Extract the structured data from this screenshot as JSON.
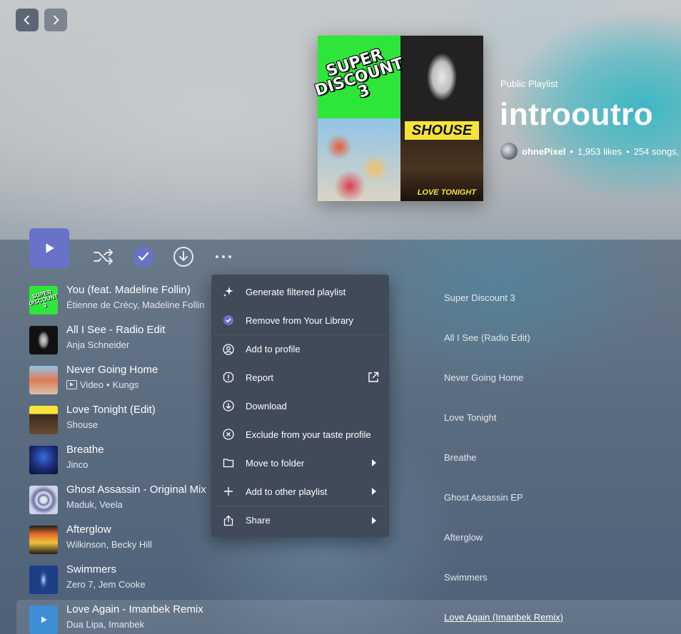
{
  "colors": {
    "accent": "#6872c8",
    "menu_bg": "#414a59"
  },
  "nav": {
    "back_icon": "chevron-left-icon",
    "forward_icon": "chevron-right-icon"
  },
  "cover": {
    "q1_text": "SUPER DISCOUNT 3",
    "q4_text": "SHOUSE",
    "q4_subtext": "LOVE TONIGHT"
  },
  "playlist": {
    "type": "Public Playlist",
    "title": "introoutro",
    "owner": "ohnePixel",
    "likes": "1,953 likes",
    "songs": "254 songs,",
    "separator": "•"
  },
  "controls": {
    "play_icon": "play-icon",
    "shuffle_icon": "shuffle-icon",
    "saved_icon": "check-circle-icon",
    "download_icon": "download-icon",
    "more_icon": "more-icon"
  },
  "tracks": [
    {
      "name": "You (feat. Madeline Follin)",
      "artist": "Étienne de Crécy, Madeline Follin",
      "album": "Super Discount 3"
    },
    {
      "name": "All I See - Radio Edit",
      "artist": "Anja Schneider",
      "album": "All I See (Radio Edit)"
    },
    {
      "name": "Never Going Home",
      "artist_prefix": "Video",
      "artist": "Kungs",
      "album": "Never Going Home"
    },
    {
      "name": "Love Tonight (Edit)",
      "artist": "Shouse",
      "album": "Love Tonight"
    },
    {
      "name": "Breathe",
      "artist": "Jinco",
      "album": "Breathe"
    },
    {
      "name": "Ghost Assassin - Original Mix",
      "artist": "Maduk, Veela",
      "album": "Ghost Assassin EP"
    },
    {
      "name": "Afterglow",
      "artist": "Wilkinson, Becky Hill",
      "album": "Afterglow"
    },
    {
      "name": "Swimmers",
      "artist": "Zero 7, Jem Cooke",
      "album": "Swimmers"
    },
    {
      "name": "Love Again - Imanbek Remix",
      "artist": "Dua Lipa, Imanbek",
      "album": "Love Again (Imanbek Remix)"
    }
  ],
  "menu": {
    "items": [
      {
        "label": "Generate filtered playlist",
        "icon": "sparkle-icon"
      },
      {
        "label": "Remove from Your Library",
        "icon": "check-circle-icon"
      },
      {
        "label": "Add to profile",
        "icon": "user-circle-icon"
      },
      {
        "label": "Report",
        "icon": "report-icon",
        "tail": "external-link-icon"
      },
      {
        "label": "Download",
        "icon": "download-icon"
      },
      {
        "label": "Exclude from your taste profile",
        "icon": "exclude-icon"
      },
      {
        "label": "Move to folder",
        "icon": "folder-icon",
        "tail": "caret-right-icon"
      },
      {
        "label": "Add to other playlist",
        "icon": "plus-icon",
        "tail": "caret-right-icon"
      },
      {
        "label": "Share",
        "icon": "share-icon",
        "tail": "caret-right-icon"
      }
    ]
  }
}
